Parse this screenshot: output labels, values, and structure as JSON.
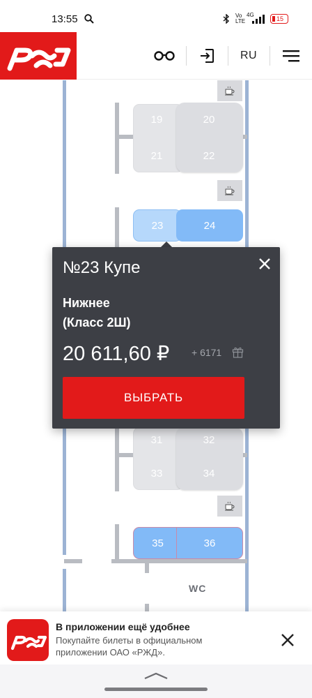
{
  "status_bar": {
    "time": "13:55",
    "icons": [
      "search-icon",
      "bluetooth-icon",
      "volte-icon",
      "signal-4g-icon",
      "battery-icon"
    ],
    "network": "4G",
    "battery": "15"
  },
  "header": {
    "logo_text": "РЖД",
    "language": "RU",
    "icons": [
      "glasses-icon",
      "login-icon",
      "menu-icon"
    ]
  },
  "seat_map": {
    "compartments": [
      {
        "seats": [
          {
            "number": "19",
            "state": "occupied"
          },
          {
            "number": "20",
            "state": "occupied"
          },
          {
            "number": "21",
            "state": "occupied"
          },
          {
            "number": "22",
            "state": "occupied"
          }
        ]
      },
      {
        "seats": [
          {
            "number": "23",
            "state": "selected"
          },
          {
            "number": "24",
            "state": "free"
          }
        ]
      },
      {
        "seats": [
          {
            "number": "31",
            "state": "occupied"
          },
          {
            "number": "32",
            "state": "occupied"
          },
          {
            "number": "33",
            "state": "occupied"
          },
          {
            "number": "34",
            "state": "occupied"
          }
        ]
      },
      {
        "seats": [
          {
            "number": "35",
            "state": "free"
          },
          {
            "number": "36",
            "state": "free"
          }
        ]
      }
    ],
    "wc_label": "WC"
  },
  "popup": {
    "title": "№23 Купе",
    "seat_line1": "Нижнее",
    "seat_line2": "(Класс 2Ш)",
    "price": "20 611,60 ₽",
    "bonus": "+ 6171",
    "select_button": "ВЫБРАТЬ"
  },
  "app_banner": {
    "logo_text": "РЖД",
    "title": "В приложении ещё удобнее",
    "text": "Покупайте билеты в официальном приложении ОАО «РЖД»."
  },
  "colors": {
    "brand_red": "#e21a1a",
    "popup_bg": "#3d3f45",
    "seat_free": "#82baf7",
    "seat_selected": "#b6d8fb",
    "seat_occupied": "#e4e5e8",
    "wall": "#9cb3d4"
  }
}
